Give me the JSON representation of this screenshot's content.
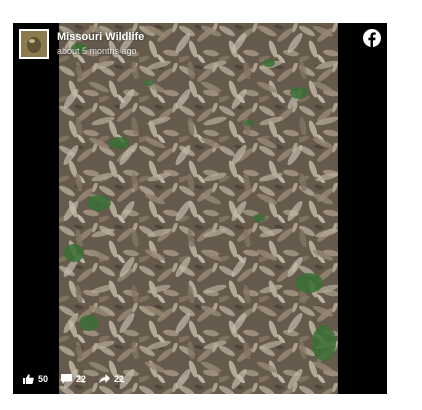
{
  "post": {
    "page_name": "Missouri Wildlife",
    "timestamp": "about 5 months ago"
  },
  "icons": {
    "platform": "facebook-icon",
    "like": "thumbs-up-icon",
    "comment": "comment-bubble-icon",
    "share": "share-arrow-icon"
  },
  "stats": {
    "likes": "50",
    "comments": "22",
    "shares": "22"
  },
  "colors": {
    "background": "#000000",
    "text": "#ffffff"
  }
}
